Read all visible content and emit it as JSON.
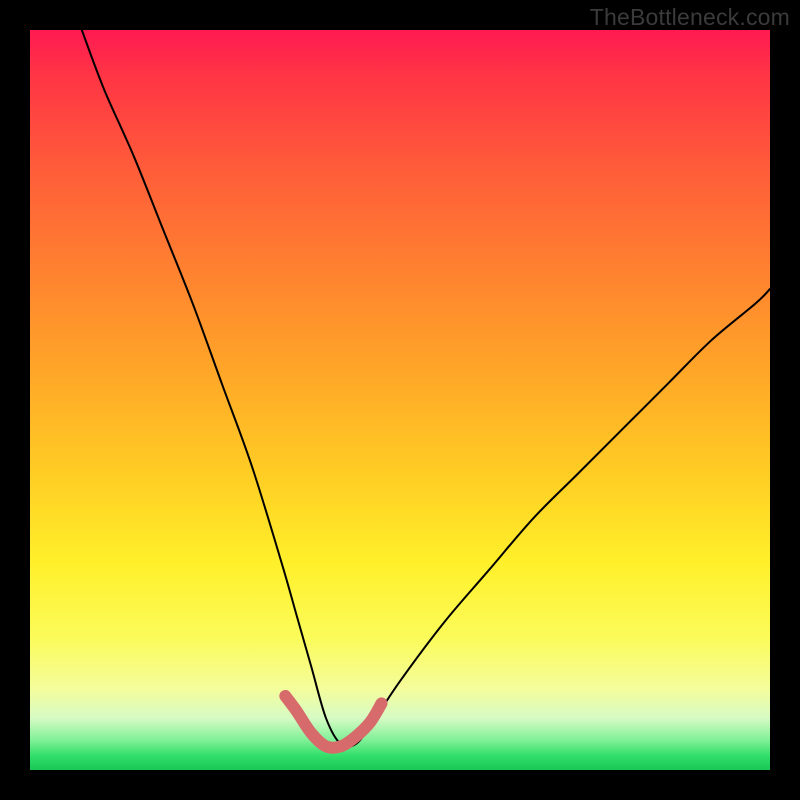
{
  "watermark": "TheBottleneck.com",
  "colors": {
    "frame": "#000000",
    "curve": "#000000",
    "highlight": "#d76b6c",
    "watermark": "#3b3b3b"
  },
  "chart_data": {
    "type": "line",
    "title": "",
    "xlabel": "",
    "ylabel": "",
    "xlim": [
      0,
      100
    ],
    "ylim": [
      0,
      100
    ],
    "grid": false,
    "legend": false,
    "notes": "V-shaped bottleneck curve on rainbow gradient; no axis ticks or labels shown. Lower is better (green band at bottom).",
    "series": [
      {
        "name": "bottleneck-curve",
        "x": [
          7,
          10,
          14,
          18,
          22,
          26,
          30,
          34,
          36,
          38,
          40,
          42,
          44,
          46,
          50,
          56,
          62,
          68,
          74,
          80,
          86,
          92,
          98,
          100
        ],
        "y": [
          100,
          92,
          83,
          73,
          63,
          52,
          41,
          28,
          21,
          14,
          7,
          3.5,
          3.5,
          6,
          12,
          20,
          27,
          34,
          40,
          46,
          52,
          58,
          63,
          65
        ]
      },
      {
        "name": "highlight-band",
        "x": [
          34.5,
          36,
          38,
          40,
          42,
          44,
          46,
          47.5
        ],
        "y": [
          10,
          8,
          5,
          3.2,
          3.2,
          4.5,
          6.5,
          9
        ]
      }
    ]
  }
}
